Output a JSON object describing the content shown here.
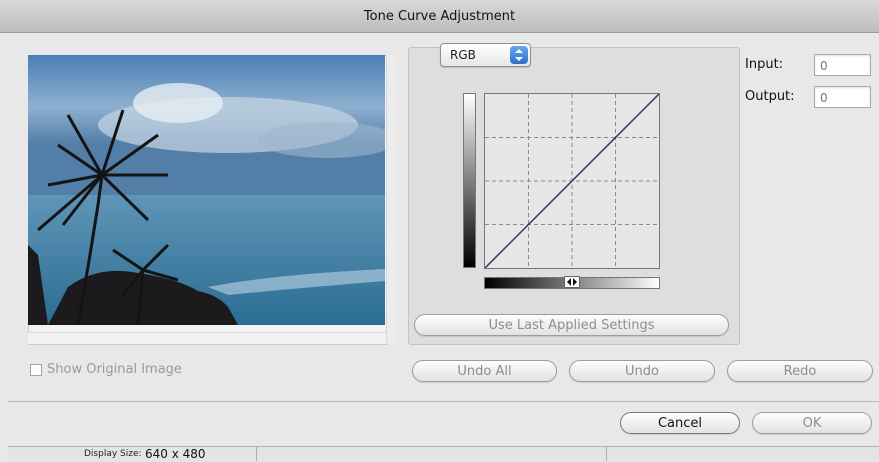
{
  "window": {
    "title": "Tone Curve Adjustment"
  },
  "channel": {
    "selected": "RGB"
  },
  "fields": {
    "input_label": "Input:",
    "input_value": "0",
    "output_label": "Output:",
    "output_value": "0"
  },
  "buttons": {
    "use_last": "Use Last Applied Settings",
    "undo_all": "Undo All",
    "undo": "Undo",
    "redo": "Redo",
    "cancel": "Cancel",
    "ok": "OK"
  },
  "show_original": {
    "label": "Show Original Image",
    "checked": false
  },
  "status": {
    "display_size_label": "Display Size:",
    "display_size_value": "640 x 480"
  },
  "icons": {
    "channel_arrows": "up-down-arrows-icon",
    "slider_handle": "slider-handle-icon"
  }
}
